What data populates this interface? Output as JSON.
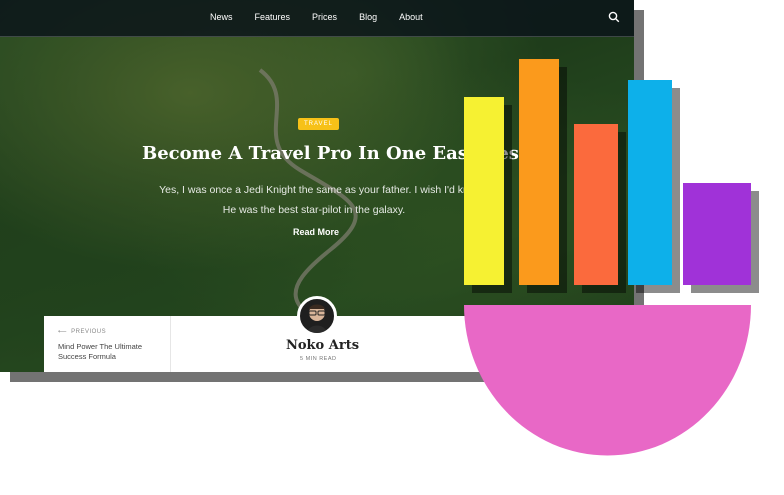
{
  "nav": {
    "items": [
      "News",
      "Features",
      "Prices",
      "Blog",
      "About"
    ]
  },
  "hero": {
    "badge": "TRAVEL",
    "title": "Become A Travel Pro In One Easy Less",
    "subtitle_line1": "Yes, I was once a Jedi Knight the same as your father. I wish I'd kn",
    "subtitle_line2": "He was the best star-pilot in the galaxy.",
    "read_more": "Read More"
  },
  "bottom": {
    "prev_label": "PREVIOUS",
    "prev_title": "Mind Power The Ultimate Success Formula",
    "author": "Noko Arts",
    "min_read": "5 MIN READ"
  },
  "colors": {
    "bar1": "#f6f132",
    "bar2": "#fb9a1e",
    "bar3": "#fb6a3e",
    "bar4": "#0ab0ea",
    "bar5": "#a030d8",
    "bowl": "#e868c6",
    "badge": "#f7c118"
  }
}
